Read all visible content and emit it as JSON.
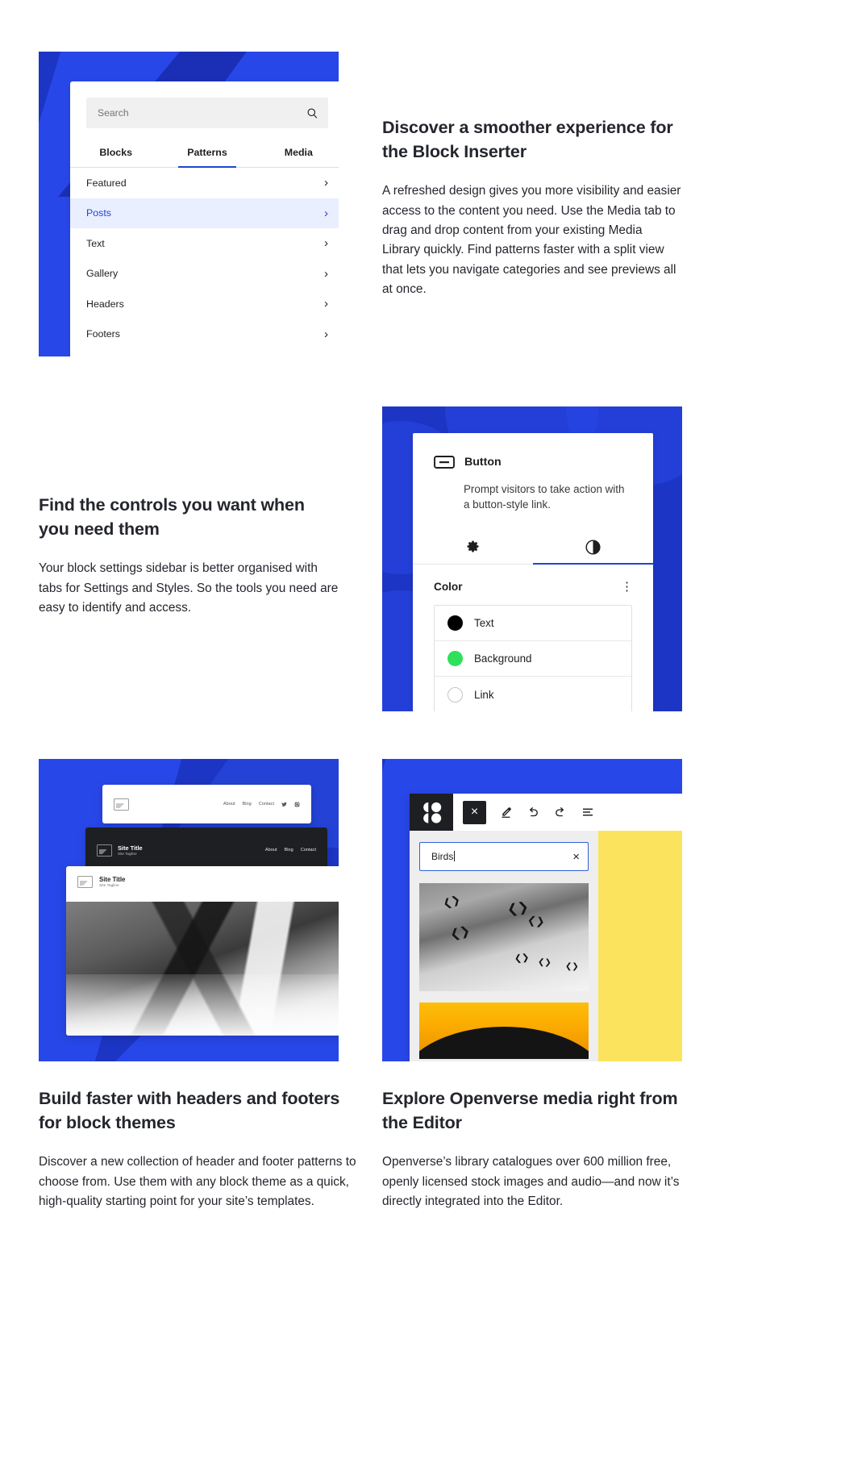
{
  "sections": [
    {
      "id": "block-inserter",
      "heading": "Discover a smoother experience for the Block Inserter",
      "body": "A refreshed design gives you more visibility and easier access to the content you need. Use the Media tab to drag and drop content from your existing Media Library quickly. Find patterns faster with a split view that lets you navigate categories and see previews all at once."
    },
    {
      "id": "block-controls",
      "heading": "Find the controls you want when you need them",
      "body": "Your block settings sidebar is better organised with tabs for Settings and Styles. So the tools you need are easy to identify and access."
    },
    {
      "id": "headers-footers",
      "heading": "Build faster with headers and footers for block themes",
      "body": "Discover a new collection of header and footer patterns to choose from. Use them with any block theme as a quick, high-quality starting point for your site’s templates."
    },
    {
      "id": "openverse",
      "heading": "Explore Openverse media right from the Editor",
      "body": "Openverse’s library catalogues over 600 million free, openly licensed stock images and audio—and now it’s directly integrated into the Editor."
    }
  ],
  "inserter": {
    "search_placeholder": "Search",
    "search_value": "",
    "tabs": [
      {
        "label": "Blocks",
        "active": false
      },
      {
        "label": "Patterns",
        "active": true
      },
      {
        "label": "Media",
        "active": false
      }
    ],
    "categories": [
      {
        "label": "Featured",
        "selected": false
      },
      {
        "label": "Posts",
        "selected": true
      },
      {
        "label": "Text",
        "selected": false
      },
      {
        "label": "Gallery",
        "selected": false
      },
      {
        "label": "Headers",
        "selected": false
      },
      {
        "label": "Footers",
        "selected": false
      }
    ],
    "chevron": "›"
  },
  "block_settings": {
    "block_name": "Button",
    "description": "Prompt visitors to take action with a button-style link.",
    "tabs": [
      {
        "name": "settings",
        "icon": "gear-icon",
        "active": false
      },
      {
        "name": "styles",
        "icon": "contrast-icon",
        "active": true
      }
    ],
    "section_label": "Color",
    "more_menu": "⋮",
    "color_items": [
      {
        "label": "Text",
        "swatch": "#000000"
      },
      {
        "label": "Background",
        "swatch": "#2ee05a"
      },
      {
        "label": "Link",
        "swatch": "#ffffff"
      }
    ]
  },
  "mockups": {
    "header_light": {
      "nav": [
        "About",
        "Blog",
        "Contact"
      ],
      "icons": [
        "twitter-icon",
        "instagram-icon"
      ]
    },
    "header_dark": {
      "title": "Site Title",
      "tagline": "Site Tagline",
      "nav": [
        "About",
        "Blog",
        "Contact"
      ]
    },
    "hero": {
      "title": "Site Title",
      "tagline": "Site Tagline"
    }
  },
  "editor": {
    "logo": "wordpress-openverse-logo",
    "toolbar": [
      {
        "name": "close-icon",
        "glyph": "×"
      },
      {
        "name": "edit-pencil-icon"
      },
      {
        "name": "undo-icon"
      },
      {
        "name": "redo-icon"
      },
      {
        "name": "list-view-icon"
      }
    ],
    "search_value": "Birds",
    "clear_glyph": "×"
  },
  "colors": {
    "brand_blue": "#1d35c4",
    "accent_blue": "#2847e8",
    "link_blue": "#2145cf",
    "text": "#24262d",
    "yellow": "#fbe35e",
    "green_swatch": "#2ee05a"
  }
}
